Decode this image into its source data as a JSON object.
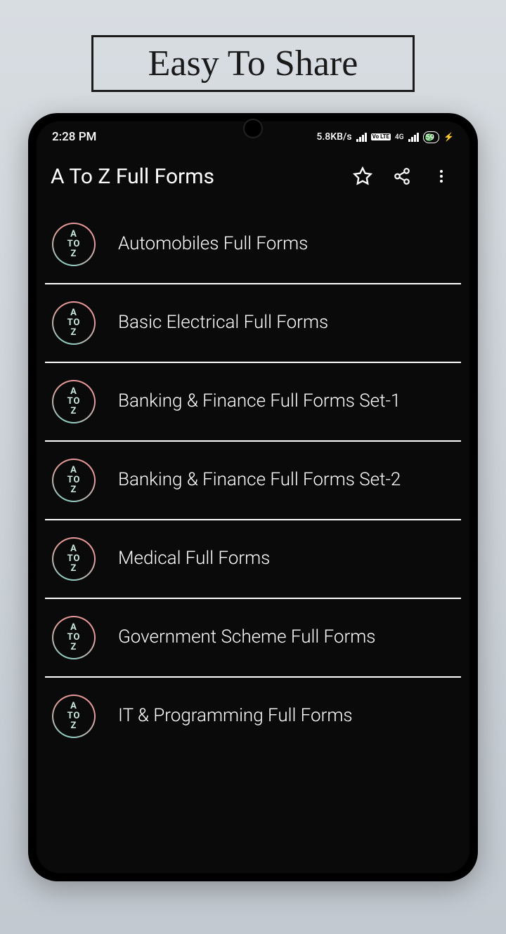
{
  "promo": {
    "text": "Easy To Share"
  },
  "status_bar": {
    "time": "2:28 PM",
    "speed": "5.8KB/s",
    "volte": "Vo LTE",
    "network": "4G",
    "battery": "59"
  },
  "app_bar": {
    "title": "A To Z Full Forms"
  },
  "icon_text": {
    "line1": "A",
    "line2": "TO",
    "line3": "Z"
  },
  "items": [
    {
      "label": "Automobiles Full Forms"
    },
    {
      "label": "Basic Electrical Full Forms"
    },
    {
      "label": "Banking & Finance Full Forms Set-1"
    },
    {
      "label": "Banking & Finance Full Forms Set-2"
    },
    {
      "label": "Medical Full Forms"
    },
    {
      "label": "Government Scheme Full Forms"
    },
    {
      "label": "IT & Programming Full Forms"
    }
  ]
}
